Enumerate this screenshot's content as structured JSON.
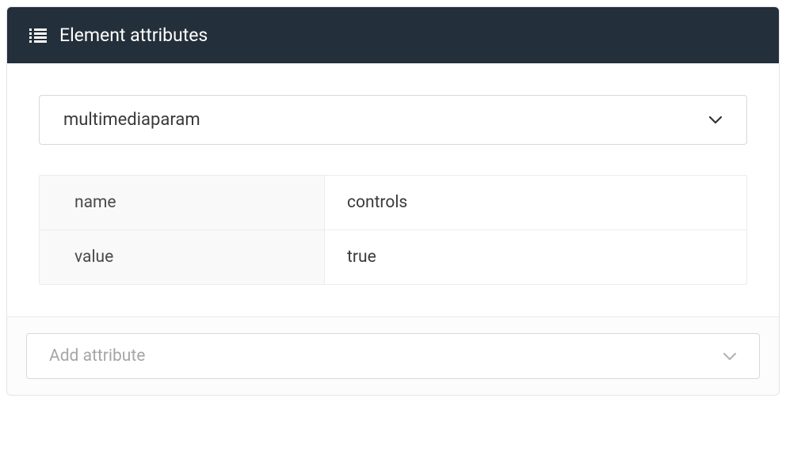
{
  "panel": {
    "title": "Element attributes"
  },
  "selector": {
    "selected": "multimediaparam"
  },
  "attributes": [
    {
      "label": "name",
      "value": "controls"
    },
    {
      "label": "value",
      "value": "true"
    }
  ],
  "footer": {
    "add_label": "Add attribute"
  }
}
